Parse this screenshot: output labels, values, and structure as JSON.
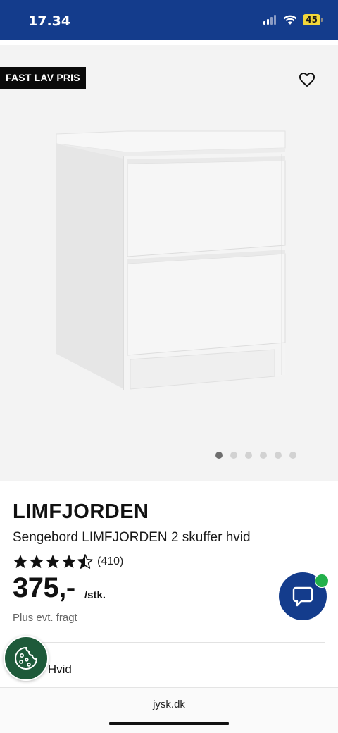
{
  "status": {
    "time": "17.34",
    "battery": "45"
  },
  "gallery": {
    "badge": "FAST LAV PRIS",
    "dots_count": 6,
    "active_dot": 0
  },
  "product": {
    "brand": "LIMFJORDEN",
    "name": "Sengebord LIMFJORDEN 2 skuffer hvid",
    "rating": 4.5,
    "rating_count": "(410)",
    "price": "375,-",
    "unit": "/stk.",
    "freight": "Plus evt. fragt",
    "color_label_partial": "e:",
    "color_value": "Hvid"
  },
  "browser": {
    "url": "jysk.dk"
  },
  "colors": {
    "brand_blue": "#143c8c",
    "badge_bg": "#0a0a0a",
    "chat_dot": "#22b04a",
    "cookie_green": "#1e5a3a"
  }
}
